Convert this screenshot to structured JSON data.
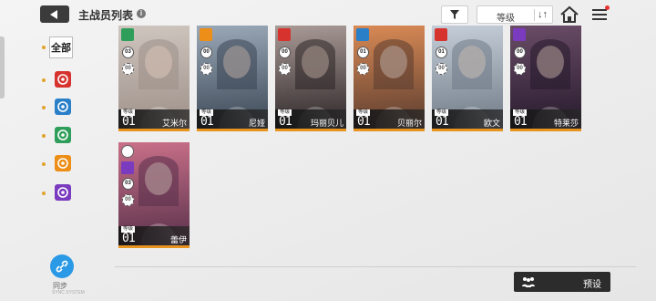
{
  "header": {
    "title": "主战员列表",
    "info_icon": "i",
    "sort_label": "等级",
    "sort_icon": "↓↑"
  },
  "filters": {
    "all_label": "全部",
    "elements": [
      {
        "name": "fire",
        "color": "#d6332f"
      },
      {
        "name": "balance",
        "color": "#2a7fc9"
      },
      {
        "name": "wind",
        "color": "#2f9e5b"
      },
      {
        "name": "light",
        "color": "#ec8e17"
      },
      {
        "name": "void",
        "color": "#7a3bbf"
      }
    ]
  },
  "sync": {
    "label": "同步",
    "sublabel": "SYNC SYSTEM"
  },
  "preset": {
    "label": "预设"
  },
  "level_tag": "等级",
  "characters": [
    {
      "name": "艾米尔",
      "level": "01",
      "element_color": "#2f9e5b",
      "stat1": "03",
      "stat2": "00",
      "art": [
        "#cfc6bf",
        "#9c8f88"
      ]
    },
    {
      "name": "尼娅",
      "level": "01",
      "element_color": "#ec8e17",
      "stat1": "00",
      "stat2": "00",
      "art": [
        "#9aa8b7",
        "#3a4654"
      ]
    },
    {
      "name": "玛丽贝儿",
      "level": "01",
      "element_color": "#d6332f",
      "stat1": "00",
      "stat2": "00",
      "art": [
        "#a99a96",
        "#2b2426"
      ]
    },
    {
      "name": "贝丽尔",
      "level": "01",
      "element_color": "#2a7fc9",
      "stat1": "01",
      "stat2": "00",
      "art": [
        "#d98a55",
        "#5a3c2f"
      ]
    },
    {
      "name": "欧文",
      "level": "01",
      "element_color": "#d6332f",
      "stat1": "01",
      "stat2": "00",
      "art": [
        "#c5ced8",
        "#6f7a86"
      ]
    },
    {
      "name": "特莱莎",
      "level": "01",
      "element_color": "#7a3bbf",
      "stat1": "00",
      "stat2": "00",
      "art": [
        "#6a4c67",
        "#261a2c"
      ]
    },
    {
      "name": "蕾伊",
      "level": "01",
      "element_color": "#7a3bbf",
      "stat1": "03",
      "stat2": "00",
      "art": [
        "#c97089",
        "#58304a"
      ],
      "has_weapon_icon": true
    }
  ]
}
